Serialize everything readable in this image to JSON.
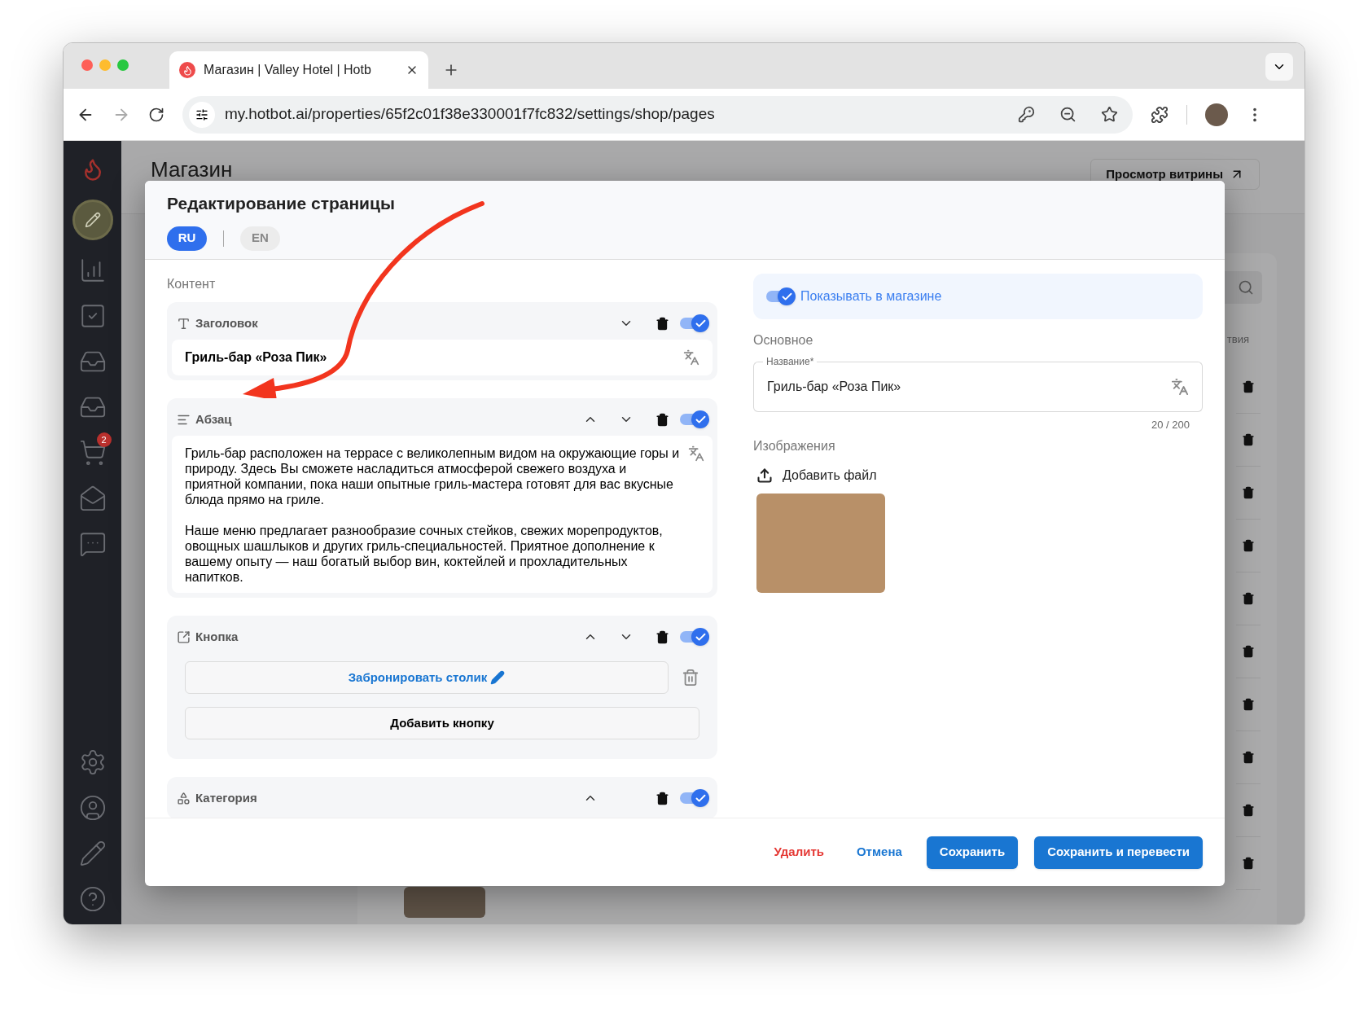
{
  "browser": {
    "tab": {
      "title": "Магазин | Valley Hotel | Hotb"
    },
    "url": "my.hotbot.ai/properties/65f2c01f38e330001f7fc832/settings/shop/pages"
  },
  "sidebar": {
    "cart_badge": "2"
  },
  "page": {
    "title": "Магазин",
    "storefront_button": "Просмотр витрины",
    "column_fragment": "твия"
  },
  "modal": {
    "title": "Редактирование страницы",
    "languages": [
      {
        "label": "RU",
        "selected": true
      },
      {
        "label": "EN",
        "selected": false
      }
    ],
    "content_label": "Контент",
    "blocks": [
      {
        "kind": "heading",
        "label": "Заголовок",
        "move_up": false,
        "move_down": true,
        "enabled": true,
        "text": "Гриль-бар «Роза Пик»"
      },
      {
        "kind": "paragraph",
        "label": "Абзац",
        "move_up": true,
        "move_down": true,
        "enabled": true,
        "paragraphs": [
          "Гриль-бар расположен на террасе с великолепным видом на окружающие горы и природу. Здесь Вы сможете насладиться атмосферой свежего воздуха и приятной компании, пока наши опытные гриль-мастера готовят для вас вкусные блюда прямо на гриле.",
          "Наше меню предлагает разнообразие сочных стейков, свежих морепродуктов, овощных шашлыков и других гриль-специальностей. Приятное дополнение к вашему опыту — наш богатый выбор вин, коктейлей и прохладительных напитков."
        ]
      },
      {
        "kind": "button",
        "label": "Кнопка",
        "move_up": true,
        "move_down": true,
        "enabled": true,
        "buttons": [
          "Забронировать столик"
        ],
        "add_label": "Добавить кнопку"
      },
      {
        "kind": "category",
        "label": "Категория",
        "move_up": true,
        "move_down": false,
        "enabled": true
      }
    ],
    "show_in_shop": {
      "label": "Показывать в магазине",
      "on": true
    },
    "main_label": "Основное",
    "name_field": {
      "label": "Название*",
      "value": "Гриль-бар «Роза Пик»",
      "counter": "20 / 200"
    },
    "images_label": "Изображения",
    "add_file": "Добавить файл",
    "actions": [
      {
        "kind": "danger",
        "label": "Удалить"
      },
      {
        "kind": "text",
        "label": "Отмена"
      },
      {
        "kind": "primary",
        "label": "Сохранить"
      },
      {
        "kind": "primary",
        "label": "Сохранить и перевести"
      }
    ]
  }
}
